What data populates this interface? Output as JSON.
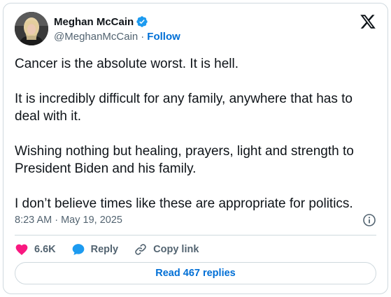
{
  "author": {
    "display_name": "Meghan McCain",
    "handle": "@MeghanMcCain",
    "separator": "·",
    "follow_label": "Follow"
  },
  "post": {
    "paragraphs": [
      "Cancer is the absolute worst. It is hell.",
      "It is incredibly difficult for any family, anywhere that has to deal with it.",
      "Wishing nothing but healing, prayers, light and strength to President Biden and his family.",
      "I don’t believe times like these are appropriate for politics."
    ],
    "timestamp": "8:23 AM · May 19, 2025"
  },
  "actions": {
    "likes_count": "6.6K",
    "reply_label": "Reply",
    "copy_link_label": "Copy link"
  },
  "footer": {
    "read_replies_label": "Read 467 replies"
  },
  "colors": {
    "accent_blue": "#006fd6",
    "like_pink": "#f91880",
    "verified_blue": "#1d9bf0",
    "muted_text": "#536471",
    "border": "#cfd9de"
  },
  "icons": {
    "logo": "x-logo-icon",
    "verified": "verified-badge-icon",
    "info": "info-icon",
    "like": "heart-icon",
    "reply": "speech-bubble-icon",
    "copy_link": "link-icon"
  }
}
